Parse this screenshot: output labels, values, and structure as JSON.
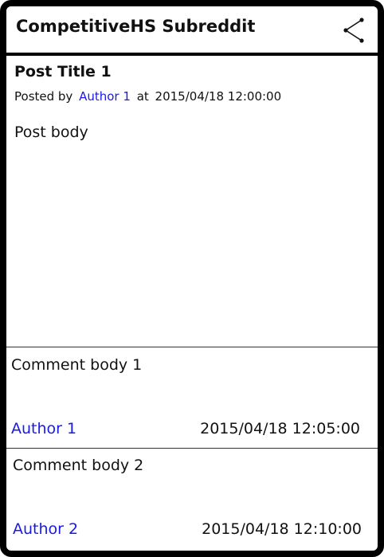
{
  "app": {
    "title": "CompetitiveHS Subreddit",
    "share_icon": "share-icon"
  },
  "post": {
    "title": "Post Title 1",
    "posted_by_label": "Posted by",
    "author": "Author 1",
    "at_label": "at",
    "timestamp": "2015/04/18 12:00:00",
    "body": "Post body"
  },
  "comments": [
    {
      "body": "Comment body 1",
      "author": "Author 1",
      "timestamp": "2015/04/18 12:05:00"
    },
    {
      "body": "Comment body 2",
      "author": "Author 2",
      "timestamp": "2015/04/18 12:10:00"
    }
  ],
  "colors": {
    "link": "#1a1ae6",
    "text": "#111111",
    "frame": "#000000"
  }
}
